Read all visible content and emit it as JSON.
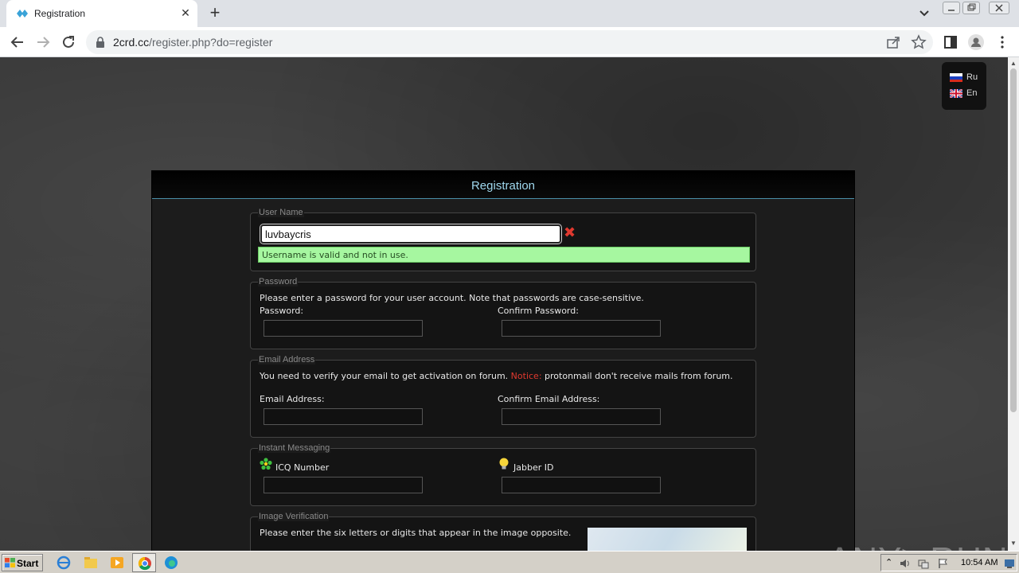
{
  "browser": {
    "tab_title": "Registration",
    "tab_close": "✕",
    "new_tab": "+",
    "url_domain": "2crd.cc",
    "url_path": "/register.php?do=register"
  },
  "lang": {
    "items": [
      {
        "label": "Ru"
      },
      {
        "label": "En"
      }
    ]
  },
  "panel": {
    "title": "Registration"
  },
  "username": {
    "legend": "User Name",
    "value": "luvbaycris",
    "status": "Username is valid and not in use."
  },
  "password": {
    "legend": "Password",
    "intro": "Please enter a password for your user account. Note that passwords are case-sensitive.",
    "label": "Password:",
    "confirm_label": "Confirm Password:"
  },
  "email": {
    "legend": "Email Address",
    "intro": "You need to verify your email to get activation on forum.",
    "notice_label": "Notice:",
    "notice_text": "protonmail don't receive mails from forum.",
    "label": "Email Address:",
    "confirm_label": "Confirm Email Address:"
  },
  "im": {
    "legend": "Instant Messaging",
    "icq_label": "ICQ Number",
    "jabber_label": "Jabber ID"
  },
  "captcha": {
    "legend": "Image Verification",
    "intro": "Please enter the six letters or digits that appear in the image opposite."
  },
  "watermark": "ANY▷RUN",
  "taskbar": {
    "start": "Start",
    "clock": "10:54 AM"
  }
}
